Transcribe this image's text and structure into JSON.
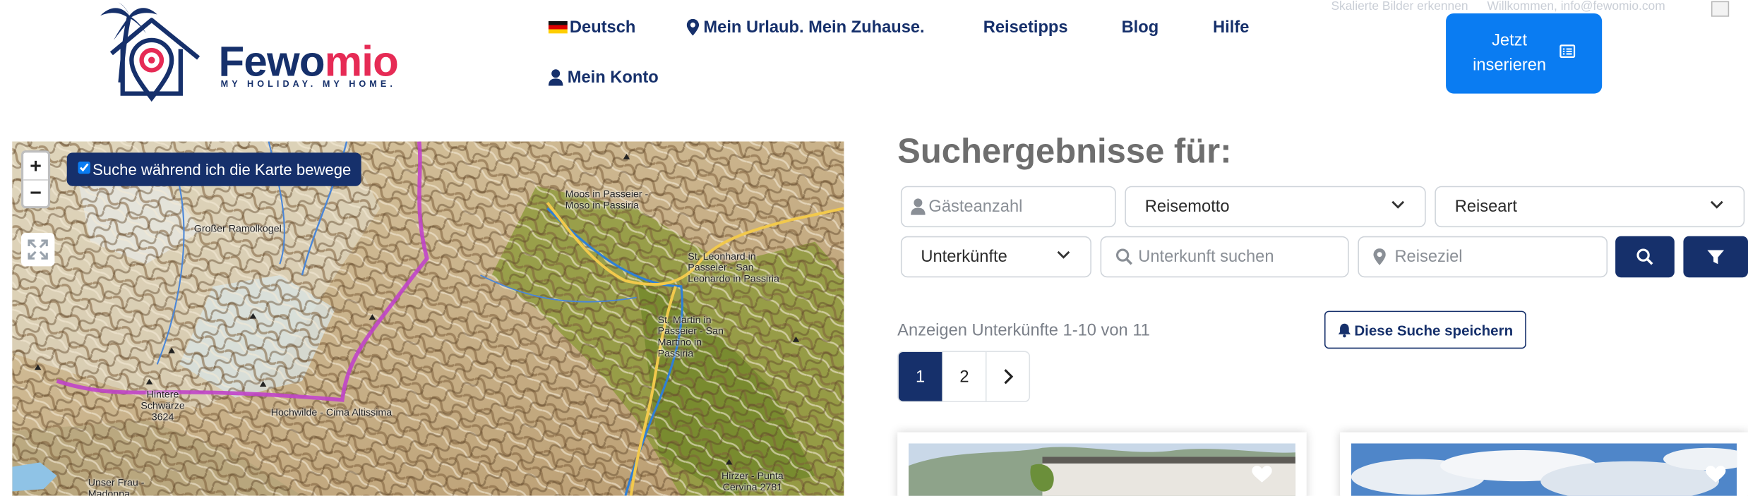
{
  "top_strip": {
    "scaled_images": "Skalierte Bilder erkennen",
    "welcome": "Willkommen, info@fewomio.com"
  },
  "logo": {
    "word_part1": "Fewo",
    "word_part2": "mio",
    "tagline": "MY HOLIDAY. MY HOME."
  },
  "nav": {
    "language": "Deutsch",
    "slogan": "Mein Urlaub. Mein Zuhause.",
    "tips": "Reisetipps",
    "blog": "Blog",
    "help": "Hilfe",
    "account": "Mein Konto"
  },
  "cta": {
    "line1": "Jetzt",
    "line2": "inserieren"
  },
  "map": {
    "zoom_in": "+",
    "zoom_out": "−",
    "search_on_move": "Suche während ich die Karte bewege",
    "search_on_move_checked": true,
    "labels": [
      "Großer Ramolkogel",
      "Moos in Passeier - Moso in Passiria",
      "St. Leonhard in Passeier - San Leonardo in Passiria",
      "St. Martin in Passeier - San Martino in Passiria",
      "Hintere Schwärze 3624",
      "Hochwilde - Cima Altissima",
      "Unser Frau - Madonna",
      "Hirzer - Punta Cervina 2781"
    ]
  },
  "results": {
    "title": "Suchergebnisse für:",
    "guests_placeholder": "Gästeanzahl",
    "travel_theme": "Reisemotto",
    "travel_type": "Reiseart",
    "accommodations": "Unterkünfte",
    "search_placeholder": "Unterkunft suchen",
    "destination_placeholder": "Reiseziel",
    "count_text": "Anzeigen Unterkünfte 1-10 von 11",
    "save_search": "Diese Suche speichern",
    "pages": [
      "1",
      "2"
    ],
    "current_page": "1",
    "next": "›"
  },
  "colors": {
    "brand_navy": "#16306b",
    "brand_pink": "#e62b55",
    "cta_blue": "#0a7cf2"
  }
}
